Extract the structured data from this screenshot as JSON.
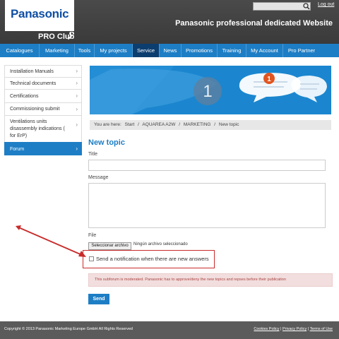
{
  "header": {
    "logo": "Panasonic",
    "proclub": "PRO Club",
    "logout": "Log out",
    "site_title": "Panasonic professional dedicated Website"
  },
  "nav": [
    "Catalogues",
    "Marketing",
    "Tools",
    "My projects",
    "Service",
    "News",
    "Promotions",
    "Training",
    "My Account",
    "Pro Partner"
  ],
  "nav_active": "Service",
  "sidebar": [
    {
      "label": "Installation Manuals"
    },
    {
      "label": "Technical documents"
    },
    {
      "label": "Certifications"
    },
    {
      "label": "Commissioning submit"
    },
    {
      "label": "Ventilations units disassembly indications ( for ErP)"
    },
    {
      "label": "Forum",
      "active": true
    }
  ],
  "banner": {
    "badge_left": "1",
    "badge_right": "1"
  },
  "breadcrumb": [
    "You are here:",
    "Start",
    "/",
    "AQUAREA A2W",
    "/",
    "MARKETING",
    "/",
    "New topic"
  ],
  "form": {
    "page_title": "New topic",
    "title_label": "Title",
    "message_label": "Message",
    "file_label": "File",
    "file_button": "Seleccionar archivo",
    "file_status": "Ningún archivo seleccionado",
    "notify_label": "Send a notification when there are new answers",
    "moderated_notice": "This subforum is moderated. Panasonic has to approve/deny the new topics and repses before their publication",
    "send": "Send"
  },
  "footer": {
    "copyright": "Copyright © 2013 Panasonic Marketing Europe GmbH All Rights Reserved",
    "links": [
      "Cookies Policy",
      "Privacy Policy",
      "Terms of Use"
    ]
  },
  "colors": {
    "brand_blue": "#1d7ec5",
    "nav_active": "#0c3d6f",
    "annotation_red": "#c92b2b"
  }
}
